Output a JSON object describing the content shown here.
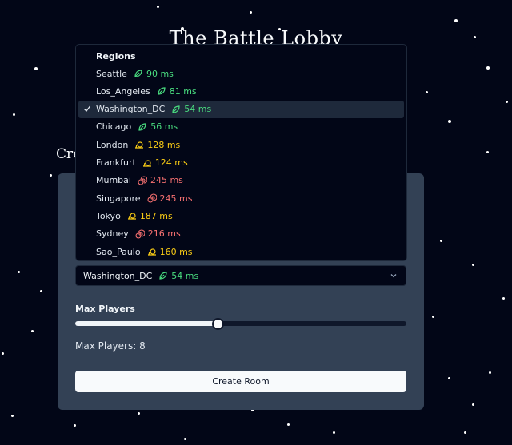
{
  "page": {
    "title": "The Battle Lobby",
    "create_heading": "Cre"
  },
  "form": {
    "selected_region": "Washington_DC",
    "selected_ping": "54 ms",
    "selected_status": "good",
    "max_players_label": "Max Players",
    "max_players_value": "Max Players: 8",
    "max_players_fraction": 0.43,
    "create_button": "Create Room"
  },
  "regions": {
    "label": "Regions",
    "items": [
      {
        "name": "Seattle",
        "ping": "90 ms",
        "status": "good"
      },
      {
        "name": "Los_Angeles",
        "ping": "81 ms",
        "status": "good"
      },
      {
        "name": "Washington_DC",
        "ping": "54 ms",
        "status": "good",
        "selected": true
      },
      {
        "name": "Chicago",
        "ping": "56 ms",
        "status": "good"
      },
      {
        "name": "London",
        "ping": "128 ms",
        "status": "mid"
      },
      {
        "name": "Frankfurt",
        "ping": "124 ms",
        "status": "mid"
      },
      {
        "name": "Mumbai",
        "ping": "245 ms",
        "status": "bad"
      },
      {
        "name": "Singapore",
        "ping": "245 ms",
        "status": "bad"
      },
      {
        "name": "Tokyo",
        "ping": "187 ms",
        "status": "mid"
      },
      {
        "name": "Sydney",
        "ping": "216 ms",
        "status": "bad"
      },
      {
        "name": "Sao_Paulo",
        "ping": "160 ms",
        "status": "mid"
      }
    ]
  },
  "colors": {
    "background": "#020617",
    "card": "#334155",
    "good": "#4ade80",
    "mid": "#facc15",
    "bad": "#f87171"
  },
  "icons": {
    "ping_good": "leaf-icon",
    "ping_mid": "snail-icon",
    "ping_bad": "spiral-icon",
    "check": "check-icon",
    "chevron": "chevron-down-icon"
  }
}
